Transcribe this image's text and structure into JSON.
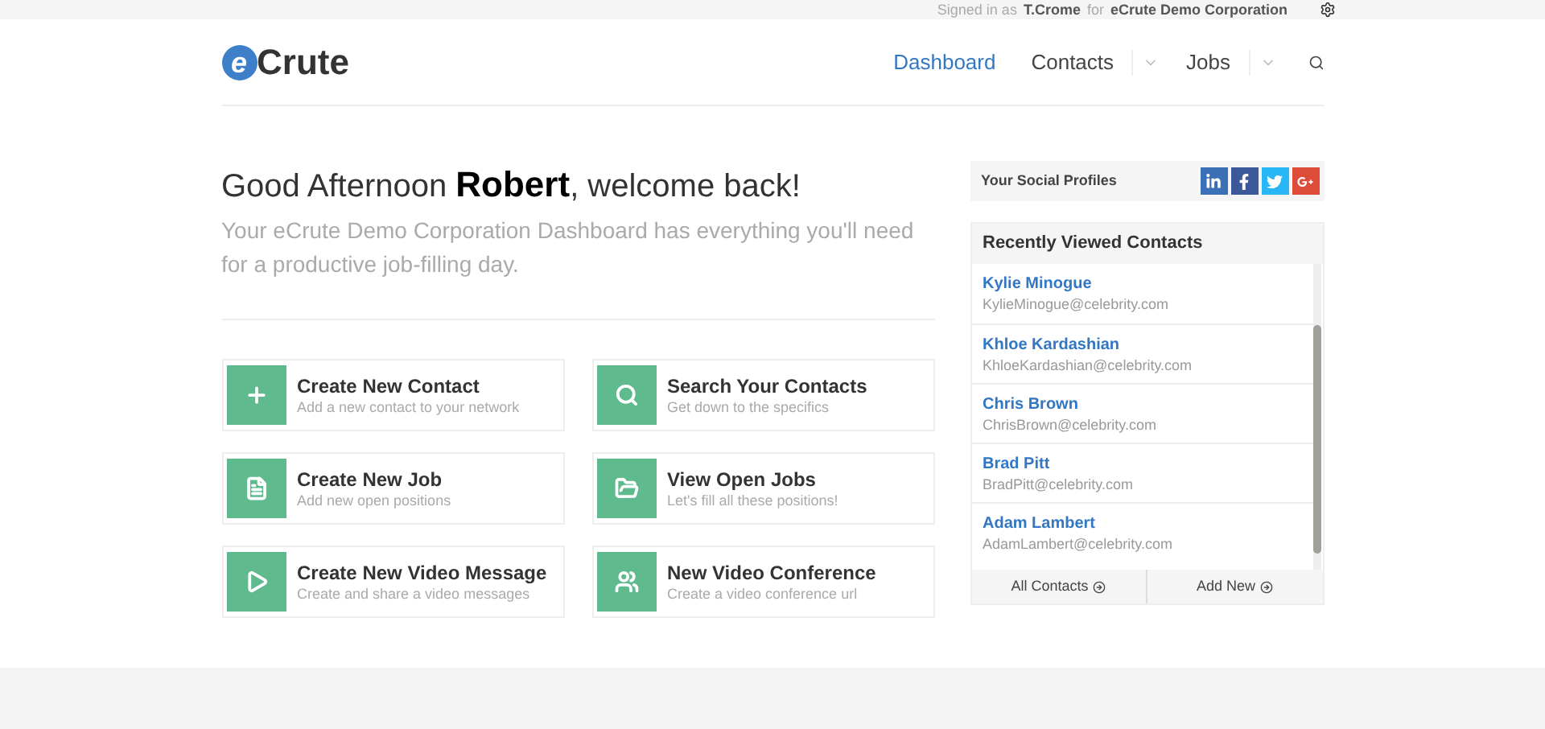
{
  "top_bar": {
    "signed_in_label": "Signed in as",
    "user": "T.Crome",
    "for_label": "for",
    "company": "eCrute Demo Corporation"
  },
  "logo": {
    "letter": "e",
    "rest": "Crute"
  },
  "nav": [
    {
      "label": "Dashboard",
      "selected": true,
      "dropdown": false
    },
    {
      "label": "Contacts",
      "selected": false,
      "dropdown": true
    },
    {
      "label": "Jobs",
      "selected": false,
      "dropdown": true
    }
  ],
  "greeting": {
    "before": "Good Afternoon",
    "name": "Robert",
    "after": ", welcome back!"
  },
  "intro": "Your eCrute Demo Corporation Dashboard has everything you'll need for a productive job-filling day.",
  "actions": [
    {
      "kind": "add",
      "title": "Create New Contact",
      "subtitle": "Add a new contact to your network"
    },
    {
      "kind": "search",
      "title": "Search Your Contacts",
      "subtitle": "Get down to the specifics"
    },
    {
      "kind": "document",
      "title": "Create New Job",
      "subtitle": "Add new open positions"
    },
    {
      "kind": "folder",
      "title": "View Open Jobs",
      "subtitle": "Let's fill all these positions!"
    },
    {
      "kind": "play",
      "title": "Create New Video Message",
      "subtitle": "Create and share a video messages"
    },
    {
      "kind": "group",
      "title": "New Video Conference",
      "subtitle": "Create a video conference url"
    }
  ],
  "social": {
    "title": "Your Social Profiles",
    "networks": [
      {
        "kind": "linkedin",
        "color": "#3b6fb6"
      },
      {
        "kind": "facebook",
        "color": "#3b5998"
      },
      {
        "kind": "twitter",
        "color": "#29b6f6"
      },
      {
        "kind": "google",
        "color": "#dd4b39"
      }
    ]
  },
  "recent_contacts": {
    "title": "Recently Viewed Contacts",
    "contacts": [
      {
        "name": "Kylie Minogue",
        "email": "KylieMinogue@celebrity.com"
      },
      {
        "name": "Khloe Kardashian",
        "email": "KhloeKardashian@celebrity.com"
      },
      {
        "name": "Chris Brown",
        "email": "ChrisBrown@celebrity.com"
      },
      {
        "name": "Brad Pitt",
        "email": "BradPitt@celebrity.com"
      },
      {
        "name": "Adam Lambert",
        "email": "AdamLambert@celebrity.com"
      }
    ],
    "buttons": [
      "All Contacts",
      "Add New"
    ]
  }
}
